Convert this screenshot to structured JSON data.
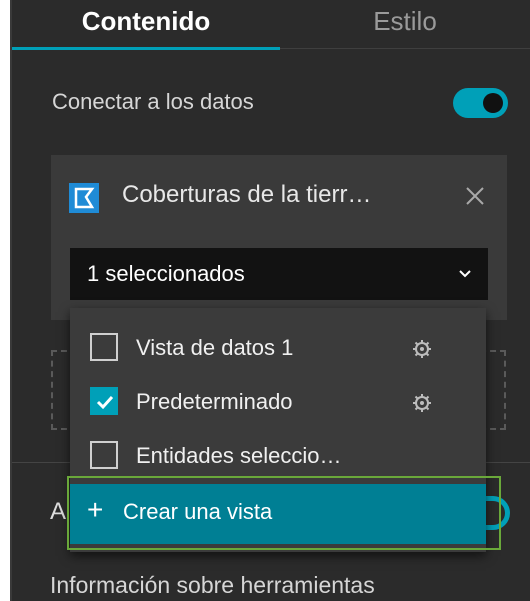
{
  "tabs": {
    "content": "Contenido",
    "style": "Estilo"
  },
  "connect": {
    "label": "Conectar a los datos",
    "toggle_on": true
  },
  "datasource": {
    "title": "Coberturas de la tierr…",
    "icon": "map-layer-icon",
    "close_icon": "close-icon",
    "select_value": "1 seleccionados"
  },
  "dropdown": {
    "items": [
      {
        "label": "Vista de datos 1",
        "checked": false,
        "has_settings": true
      },
      {
        "label": "Predeterminado",
        "checked": true,
        "has_settings": true
      },
      {
        "label": "Entidades seleccio…",
        "checked": false,
        "has_settings": false
      }
    ],
    "create_label": "Crear una vista"
  },
  "under": {
    "a_label": "A"
  },
  "footer": {
    "label": "Información sobre herramientas"
  },
  "colors": {
    "accent": "#00a0b8",
    "panel_bg": "#2b2b2b",
    "highlight_border": "#6aa83a"
  }
}
